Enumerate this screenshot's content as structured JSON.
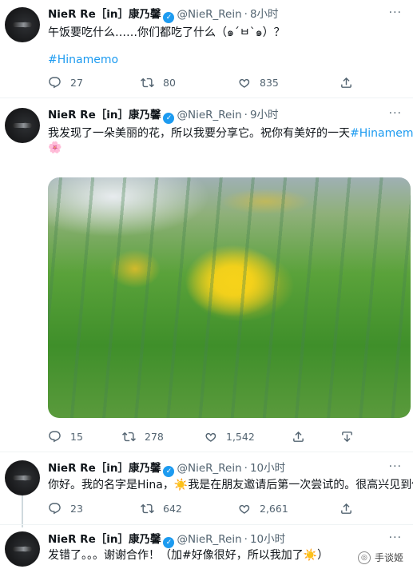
{
  "tweets": [
    {
      "name": "NieR Re［in］康乃馨",
      "handle": "@NieR_Rein",
      "sep": "·",
      "time": "8小时",
      "more": "···",
      "text": "午饭要吃什么……你们都吃了什么（๑´ㅂ`๑）？",
      "hashtag": "#Hinamemo",
      "replies": "27",
      "retweets": "80",
      "likes": "835"
    },
    {
      "name": "NieR Re［in］康乃馨",
      "handle": "@NieR_Rein",
      "sep": "·",
      "time": "9小时",
      "more": "···",
      "text": "我发现了一朵美丽的花，所以我要分享它。祝你有美好的一天",
      "hashtag": "#Hinamemo",
      "emoji": "🌸",
      "replies": "15",
      "retweets": "278",
      "likes": "1,542"
    },
    {
      "name": "NieR Re［in］康乃馨",
      "handle": "@NieR_Rein",
      "sep": "·",
      "time": "10小时",
      "more": "···",
      "text_a": "你好。我的名字是Hina，",
      "emoji": "☀️",
      "text_b": "我是在朋友邀请后第一次尝试的。很高兴见到你",
      "replies": "23",
      "retweets": "642",
      "likes": "2,661"
    },
    {
      "name": "NieR Re［in］康乃馨",
      "handle": "@NieR_Rein",
      "sep": "·",
      "time": "10小时",
      "more": "···",
      "text_a": "发错了。。。谢谢合作！（加#好像很好，所以我加了",
      "emoji": "☀️",
      "text_b": "）"
    }
  ],
  "watermark": "手谈姬",
  "colors": {
    "accent": "#1d9bf0",
    "muted": "#536471",
    "text": "#0f1419"
  }
}
